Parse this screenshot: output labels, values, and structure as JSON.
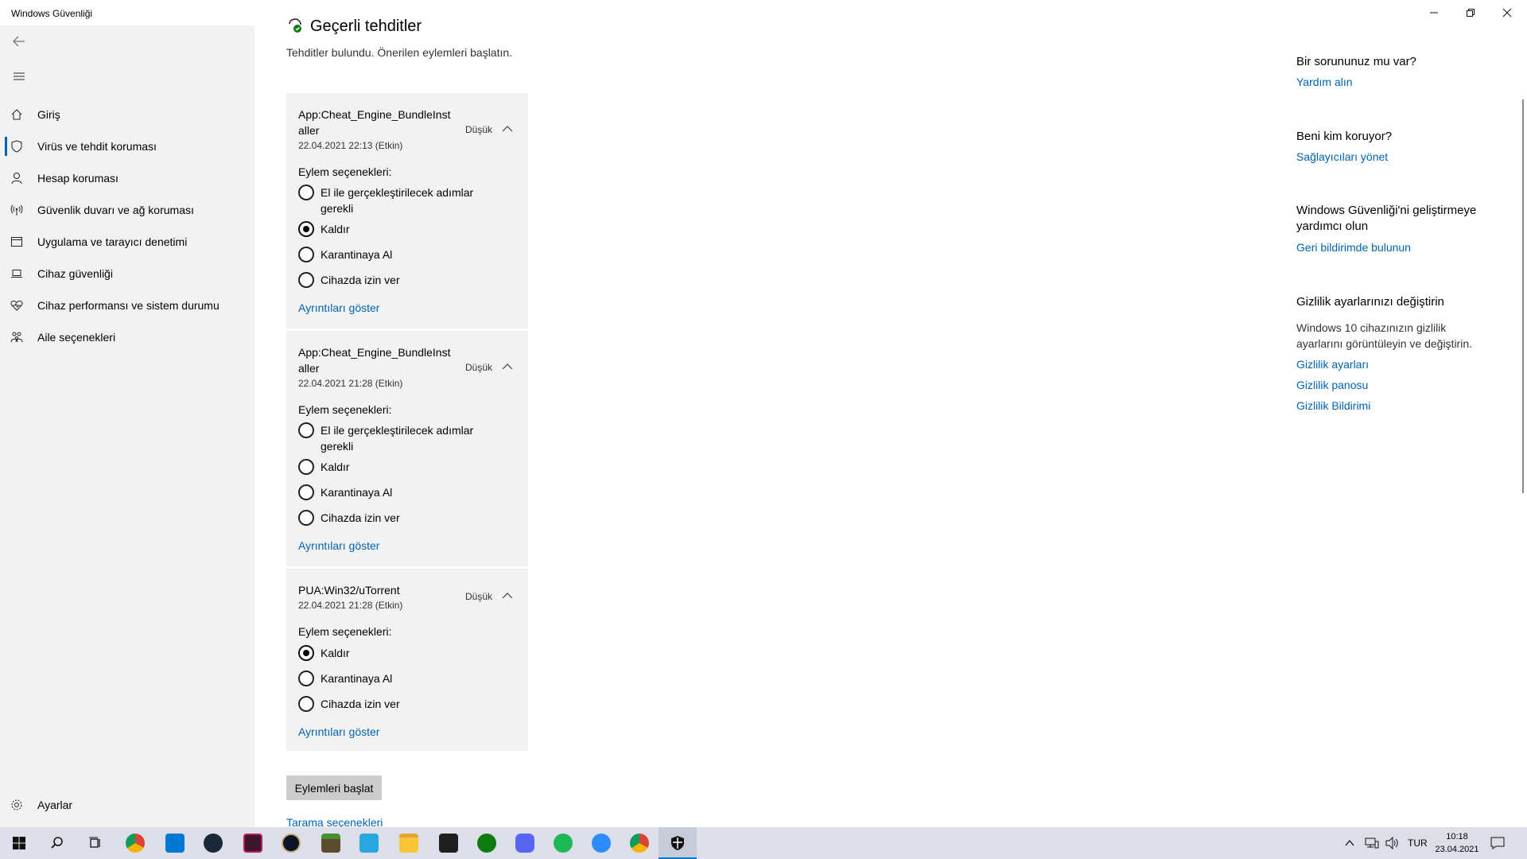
{
  "window": {
    "title": "Windows Güvenliği"
  },
  "sidebar": {
    "items": [
      {
        "label": "Giriş",
        "icon": "home-icon"
      },
      {
        "label": "Virüs ve tehdit koruması",
        "icon": "shield-icon",
        "active": true
      },
      {
        "label": "Hesap koruması",
        "icon": "person-icon"
      },
      {
        "label": "Güvenlik duvarı ve ağ koruması",
        "icon": "antenna-icon"
      },
      {
        "label": "Uygulama ve tarayıcı denetimi",
        "icon": "browser-window-icon"
      },
      {
        "label": "Cihaz güvenliği",
        "icon": "laptop-icon"
      },
      {
        "label": "Cihaz performansı ve sistem durumu",
        "icon": "heart-icon"
      },
      {
        "label": "Aile seçenekleri",
        "icon": "family-icon"
      }
    ],
    "settings_label": "Ayarlar"
  },
  "main": {
    "title": "Geçerli tehditler",
    "subtitle": "Tehditler bulundu. Önerilen eylemleri başlatın.",
    "threats": [
      {
        "name": "App:Cheat_Engine_BundleInstaller",
        "name_line1": "App:Cheat_Engine_BundleInst",
        "name_line2": "aller",
        "date": "22.04.2021 22:13 (Etkin)",
        "severity": "Düşük",
        "options_label": "Eylem seçenekleri:",
        "options": [
          {
            "label": "El ile gerçekleştirilecek adımlar gerekli",
            "checked": false
          },
          {
            "label": "Kaldır",
            "checked": true
          },
          {
            "label": "Karantinaya Al",
            "checked": false
          },
          {
            "label": "Cihazda izin ver",
            "checked": false
          }
        ],
        "details_link": "Ayrıntıları göster"
      },
      {
        "name": "App:Cheat_Engine_BundleInstaller",
        "name_line1": "App:Cheat_Engine_BundleInst",
        "name_line2": "aller",
        "date": "22.04.2021 21:28 (Etkin)",
        "severity": "Düşük",
        "options_label": "Eylem seçenekleri:",
        "options": [
          {
            "label": "El ile gerçekleştirilecek adımlar gerekli",
            "checked": false
          },
          {
            "label": "Kaldır",
            "checked": false
          },
          {
            "label": "Karantinaya Al",
            "checked": false
          },
          {
            "label": "Cihazda izin ver",
            "checked": false
          }
        ],
        "details_link": "Ayrıntıları göster"
      },
      {
        "name": "PUA:Win32/uTorrent",
        "date": "22.04.2021 21:28 (Etkin)",
        "severity": "Düşük",
        "options_label": "Eylem seçenekleri:",
        "options": [
          {
            "label": "Kaldır",
            "checked": true
          },
          {
            "label": "Karantinaya Al",
            "checked": false
          },
          {
            "label": "Cihazda izin ver",
            "checked": false
          }
        ],
        "details_link": "Ayrıntıları göster"
      }
    ],
    "start_actions_label": "Eylemleri başlat",
    "scan_options_link": "Tarama seçenekleri"
  },
  "right_panel": {
    "help_heading": "Bir sorununuz mu var?",
    "help_link": "Yardım alın",
    "who_heading": "Beni kim koruyor?",
    "who_link": "Sağlayıcıları yönet",
    "improve_heading": "Windows Güvenliği'ni geliştirmeye yardımcı olun",
    "improve_link": "Geri bildirimde bulunun",
    "privacy_heading": "Gizlilik ayarlarınızı değiştirin",
    "privacy_text": "Windows 10 cihazınızın gizlilik ayarlarını görüntüleyin ve değiştirin.",
    "privacy_links": [
      "Gizlilik ayarları",
      "Gizlilik panosu",
      "Gizlilik Bildirimi"
    ]
  },
  "taskbar": {
    "apps": [
      "start-icon",
      "search-icon",
      "task-view-icon",
      "chrome-icon",
      "mail-icon",
      "steam-icon",
      "affinity-icon",
      "league-icon",
      "minecraft-icon",
      "nineteen-icon",
      "file-explorer-icon",
      "epic-games-icon",
      "xbox-icon",
      "discord-icon",
      "spotify-icon",
      "zoom-icon",
      "chrome-icon",
      "windows-security-icon"
    ],
    "language": "TUR",
    "time": "10:18",
    "date": "23.04.2021"
  },
  "colors": {
    "accent": "#0063b1",
    "sidebar_bg": "#f2f2f2",
    "taskbar_bg": "#dcdfe8"
  }
}
